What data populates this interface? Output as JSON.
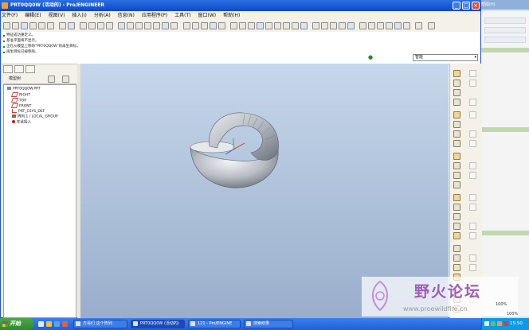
{
  "background_window": {
    "title": "帮助(H)",
    "zoom_top": "100%",
    "zoom_bottom": "100%"
  },
  "window": {
    "title": "PRT0QQ0W (活动的) - Pro/ENGINEER"
  },
  "menu": [
    "文件(F)",
    "编辑(E)",
    "视图(V)",
    "插入(I)",
    "分析(A)",
    "信息(N)",
    "应用程序(P)",
    "工具(T)",
    "窗口(W)",
    "帮助(H)"
  ],
  "messages": [
    "特征成功重定义。",
    "基准平面将不显示。",
    "正在从模型上移除\"PRT0QQ0W\"的再生目标。",
    "再生目标已被移除。"
  ],
  "filter": {
    "value": "智能"
  },
  "navigator": {
    "label": "模型树",
    "tree": [
      {
        "label": "PRT0QQ0W.PRT",
        "icon": "part-icon",
        "indent": 0
      },
      {
        "label": "RIGHT",
        "icon": "datum-plane-icon",
        "indent": 1
      },
      {
        "label": "TOP",
        "icon": "datum-plane-icon",
        "indent": 1
      },
      {
        "label": "FRONT",
        "icon": "datum-plane-icon",
        "indent": 1
      },
      {
        "label": "PRT_CSYS_DEF",
        "icon": "csys-icon",
        "indent": 1
      },
      {
        "label": "阵列 1 / LOCAL_GROUP",
        "icon": "group-icon",
        "indent": 1
      },
      {
        "label": "在此插入",
        "icon": "insert-here-icon",
        "indent": 1
      }
    ]
  },
  "watermark": {
    "text": "野火论坛",
    "url": "www.proewildfire.cn"
  },
  "taskbar": {
    "start_label": "开始",
    "tasks": [
      {
        "label": "方哥们 这个阵列",
        "active": false
      },
      {
        "label": "PRT0QQ0W (活动的)",
        "active": true
      },
      {
        "label": "121 - Pro/ENGINE",
        "active": false
      },
      {
        "label": "搜索结果",
        "active": false
      }
    ],
    "clock": "15:50"
  },
  "colors": {
    "titlebar": "#0c49c9",
    "graphics_top": "#c6d7ea",
    "graphics_bottom": "#9aaecc",
    "model": "#b9bdc4",
    "watermark": "#a05cb8"
  }
}
